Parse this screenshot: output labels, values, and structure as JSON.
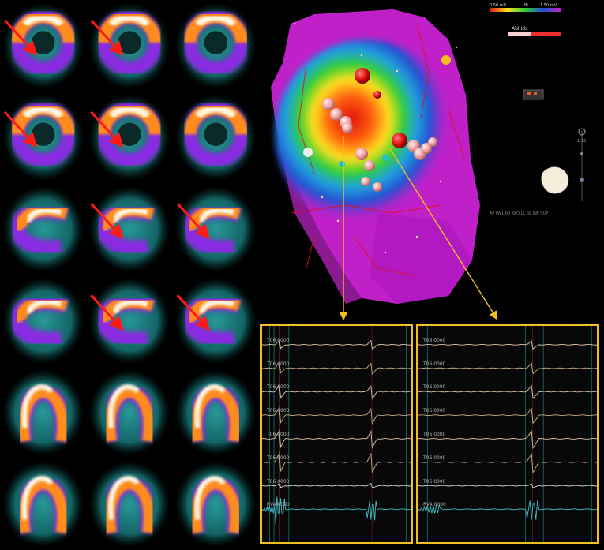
{
  "spect": {
    "rows": 6,
    "cols": 3,
    "arrows": [
      {
        "row": 0,
        "col": 0
      },
      {
        "row": 0,
        "col": 1
      },
      {
        "row": 1,
        "col": 0
      },
      {
        "row": 1,
        "col": 1
      },
      {
        "row": 2,
        "col": 1
      },
      {
        "row": 2,
        "col": 2
      },
      {
        "row": 3,
        "col": 1
      },
      {
        "row": 3,
        "col": 2
      }
    ],
    "colors": {
      "background": "#000000",
      "low": "#1a8a8a",
      "mid": "#8a2be2",
      "high": "#ff8c1a",
      "peak": "#fff6e0",
      "arrow": "#ff1a1a"
    }
  },
  "map": {
    "scale_low": "0.50 mV",
    "scale_mid": "Bi",
    "scale_high": "1.50 mV",
    "ablation_label": "Abl.Idx",
    "view_labels": "AP  PA  LAO  RAO  LL  RL  INF  SUP",
    "counter": "1 13",
    "colors": {
      "healthy": "#c020c8",
      "scar": "#e01010",
      "border": "#20c020",
      "lesion": "#f0a0a0",
      "connector": "#f0c020"
    }
  },
  "egm_left": {
    "traces": 8,
    "labels": [
      "T06 0000",
      "T06 0000",
      "T06 0000",
      "T06 0000",
      "T06 0000",
      "T06 0000",
      "T06 0000",
      "RVA 0000"
    ]
  },
  "egm_right": {
    "traces": 8,
    "labels": [
      "T06 0000",
      "T06 0000",
      "T06 0000",
      "T06 0000",
      "T06 0000",
      "T06 0000",
      "T06 0000",
      "RVA 0000"
    ]
  }
}
